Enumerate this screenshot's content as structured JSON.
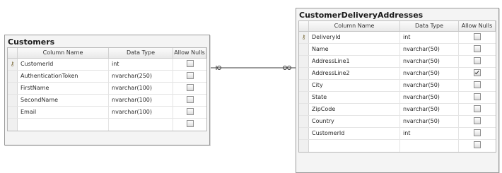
{
  "columns_header": {
    "name": "Column Name",
    "type": "Data Type",
    "nulls": "Allow Nulls"
  },
  "customers": {
    "title": "Customers",
    "rows": [
      {
        "name": "CustomerId",
        "type": "int",
        "nulls": false,
        "key": true
      },
      {
        "name": "AuthenticationToken",
        "type": "nvarchar(250)",
        "nulls": false,
        "key": false
      },
      {
        "name": "FirstName",
        "type": "nvarchar(100)",
        "nulls": false,
        "key": false
      },
      {
        "name": "SecondName",
        "type": "nvarchar(100)",
        "nulls": false,
        "key": false
      },
      {
        "name": "Email",
        "type": "nvarchar(100)",
        "nulls": false,
        "key": false
      },
      {
        "name": "",
        "type": "",
        "nulls": false,
        "key": false
      }
    ]
  },
  "delivery": {
    "title": "CustomerDeliveryAddresses",
    "rows": [
      {
        "name": "DeliveryId",
        "type": "int",
        "nulls": false,
        "key": true
      },
      {
        "name": "Name",
        "type": "nvarchar(50)",
        "nulls": false,
        "key": false
      },
      {
        "name": "AddressLine1",
        "type": "nvarchar(50)",
        "nulls": false,
        "key": false
      },
      {
        "name": "AddressLine2",
        "type": "nvarchar(50)",
        "nulls": true,
        "key": false
      },
      {
        "name": "City",
        "type": "nvarchar(50)",
        "nulls": false,
        "key": false
      },
      {
        "name": "State",
        "type": "nvarchar(50)",
        "nulls": false,
        "key": false
      },
      {
        "name": "ZipCode",
        "type": "nvarchar(50)",
        "nulls": false,
        "key": false
      },
      {
        "name": "Country",
        "type": "nvarchar(50)",
        "nulls": false,
        "key": false
      },
      {
        "name": "CustomerId",
        "type": "int",
        "nulls": false,
        "key": false
      },
      {
        "name": "",
        "type": "",
        "nulls": false,
        "key": false
      }
    ]
  }
}
